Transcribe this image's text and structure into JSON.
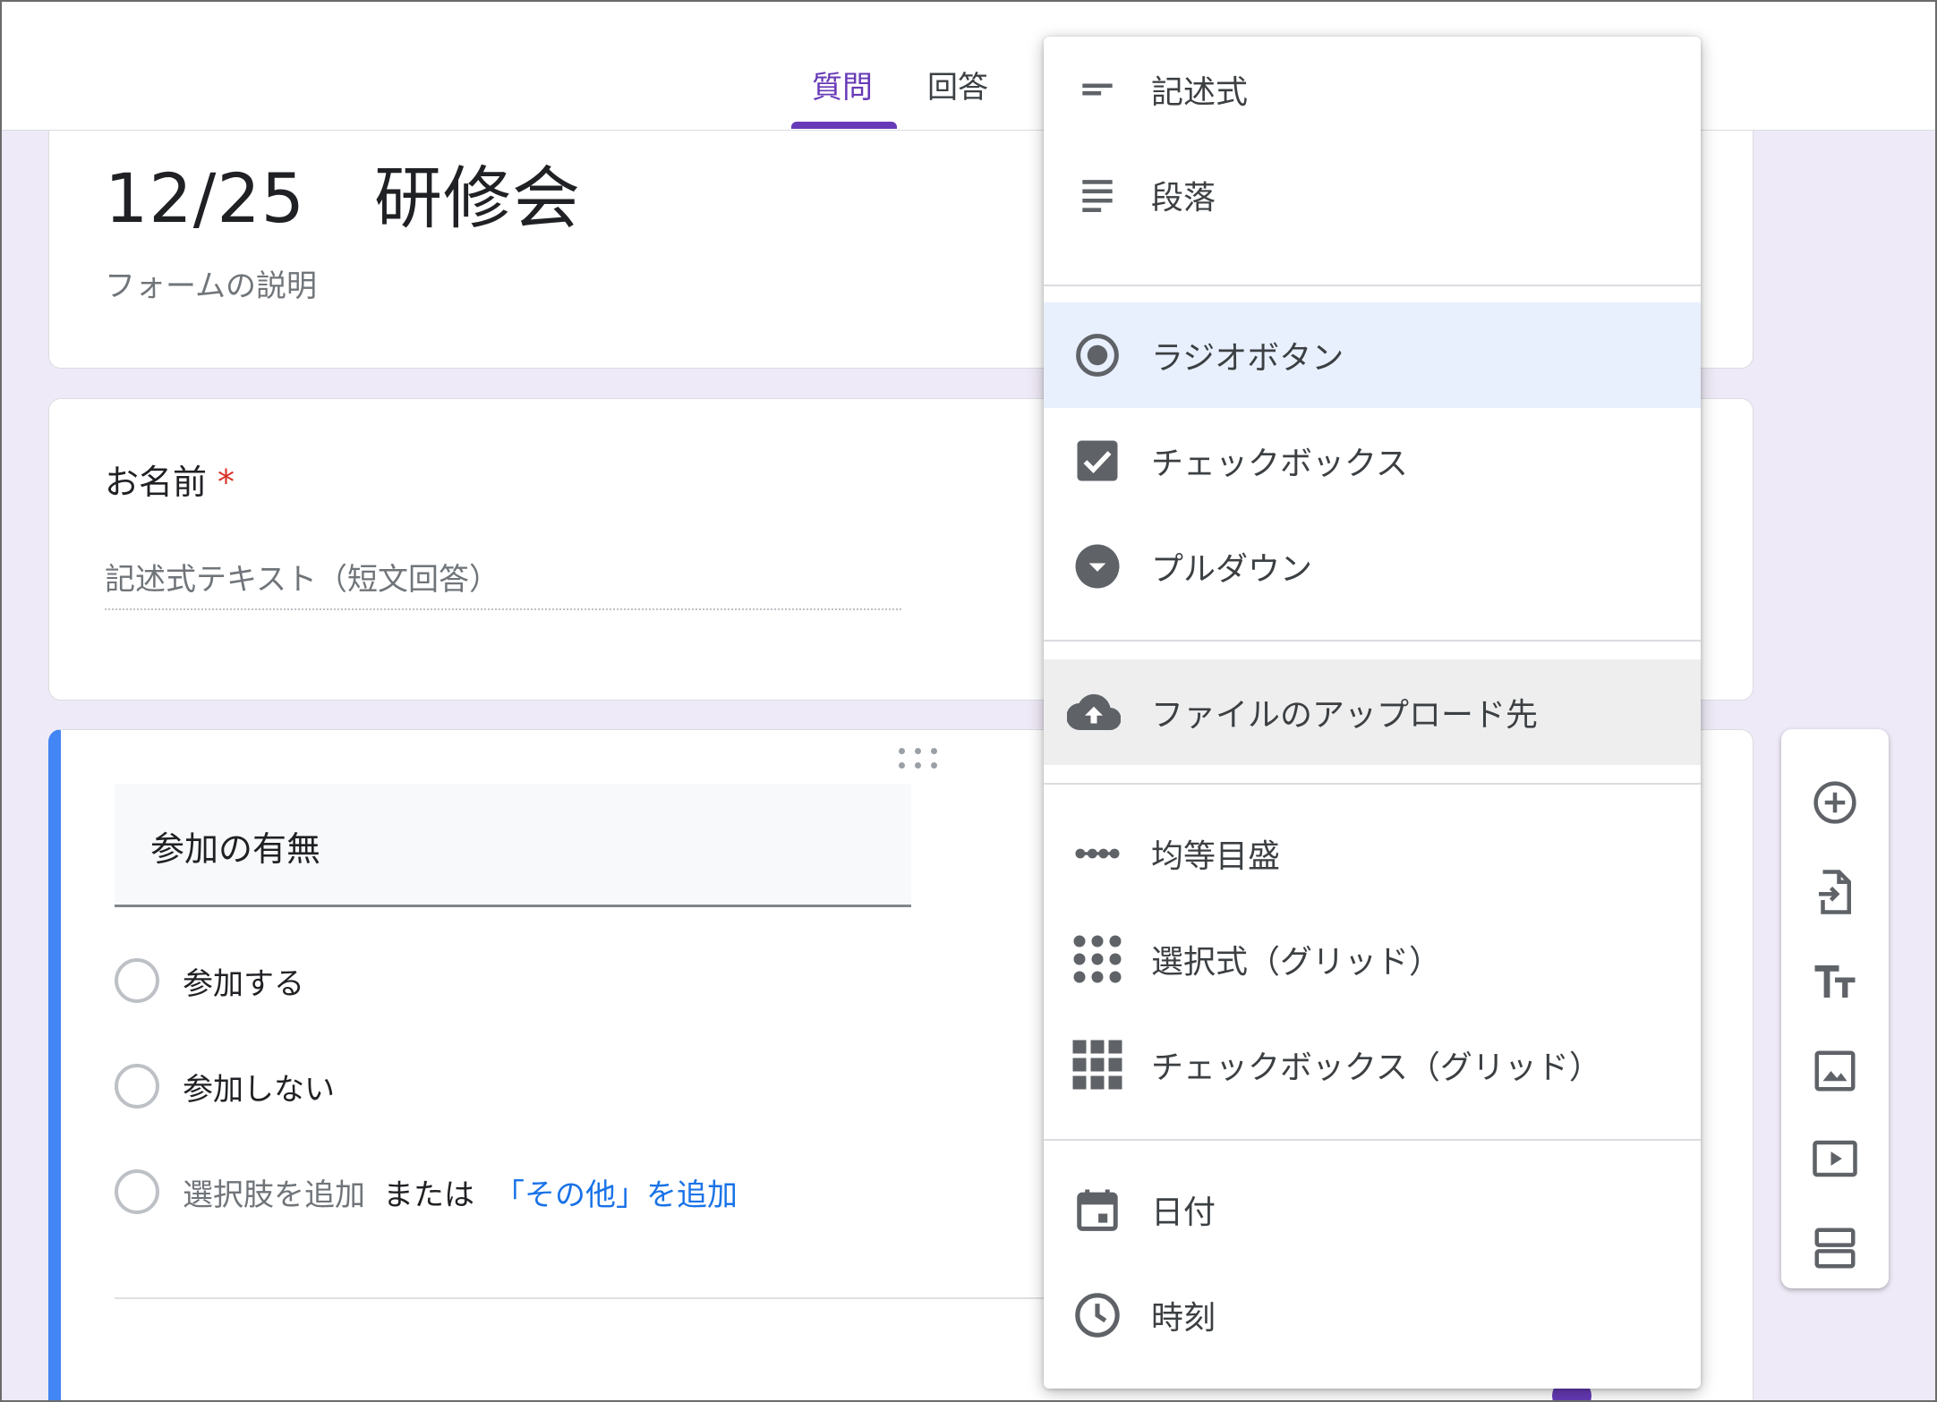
{
  "header": {
    "tabs": [
      {
        "label": "質問",
        "active": true
      },
      {
        "label": "回答",
        "active": false
      }
    ]
  },
  "form": {
    "title": "12/25　研修会",
    "description_placeholder": "フォームの説明"
  },
  "questions": [
    {
      "title": "お名前",
      "required_mark": "*",
      "answer_placeholder": "記述式テキスト（短文回答）"
    },
    {
      "title": "参加の有無",
      "options": [
        "参加する",
        "参加しない"
      ],
      "add_option": "選択肢を追加",
      "or_text": "または",
      "add_other": "「その他」を追加"
    }
  ],
  "question_type_menu": {
    "items": [
      {
        "label": "記述式",
        "icon": "short-answer-icon"
      },
      {
        "label": "段落",
        "icon": "paragraph-icon"
      },
      {
        "label": "ラジオボタン",
        "icon": "radio-button-icon",
        "selected": true
      },
      {
        "label": "チェックボックス",
        "icon": "checkbox-icon"
      },
      {
        "label": "プルダウン",
        "icon": "dropdown-icon"
      },
      {
        "label": "ファイルのアップロード先",
        "icon": "cloud-upload-icon",
        "hover": true
      },
      {
        "label": "均等目盛",
        "icon": "linear-scale-icon"
      },
      {
        "label": "選択式（グリッド）",
        "icon": "multiple-choice-grid-icon"
      },
      {
        "label": "チェックボックス（グリッド）",
        "icon": "checkbox-grid-icon"
      },
      {
        "label": "日付",
        "icon": "calendar-icon"
      },
      {
        "label": "時刻",
        "icon": "clock-icon"
      }
    ]
  },
  "toolbar": {
    "buttons": [
      "add-question-icon",
      "import-questions-icon",
      "add-title-icon",
      "add-image-icon",
      "add-video-icon",
      "add-section-icon"
    ]
  },
  "colors": {
    "accent": "#673ab7",
    "active_card_border": "#4285f4",
    "link": "#1a73e8",
    "required": "#d93025",
    "selected_item_bg": "#e8f0fe",
    "hover_item_bg": "#eeeeee",
    "page_bg": "#efeaf7"
  }
}
